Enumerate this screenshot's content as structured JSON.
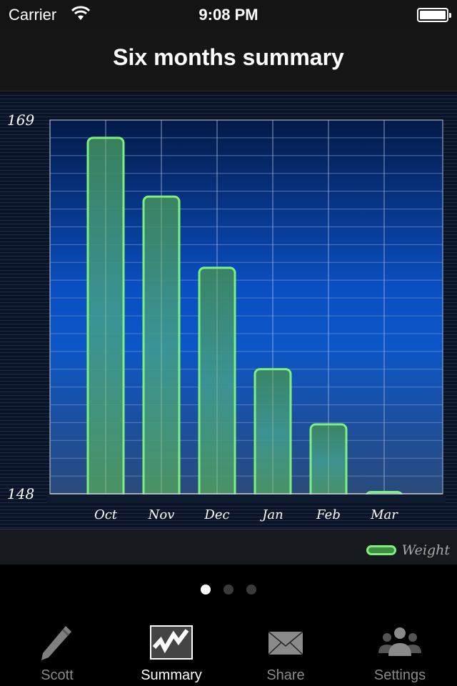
{
  "status": {
    "carrier": "Carrier",
    "time": "9:08 PM"
  },
  "nav": {
    "title": "Six months summary"
  },
  "chart_data": {
    "type": "bar",
    "categories": [
      "Oct",
      "Nov",
      "Dec",
      "Jan",
      "Feb",
      "Mar"
    ],
    "series": [
      {
        "name": "Weight",
        "values": [
          168,
          164.7,
          160.7,
          155,
          151.9,
          148.1
        ]
      }
    ],
    "ylim": [
      148,
      169
    ],
    "yticks": [
      "148",
      "169"
    ],
    "grid": true,
    "legend": "bottom-right",
    "colors": {
      "bar_stroke": "#7ef07e",
      "bar_fill": "#4a9a6a"
    }
  },
  "pager": {
    "count": 3,
    "active": 0
  },
  "tabs": [
    {
      "label": "Scott",
      "icon": "pencil-icon"
    },
    {
      "label": "Summary",
      "icon": "chart-icon",
      "active": true
    },
    {
      "label": "Share",
      "icon": "envelope-icon"
    },
    {
      "label": "Settings",
      "icon": "users-icon"
    }
  ]
}
